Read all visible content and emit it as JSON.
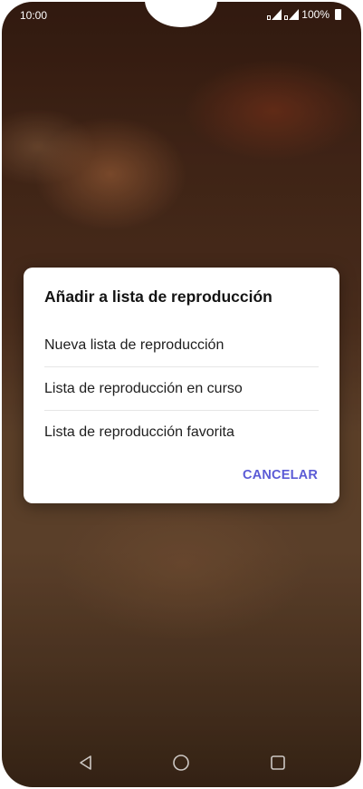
{
  "status_bar": {
    "time": "10:00",
    "battery_percent": "100%",
    "icons": [
      "signal-icon",
      "signal-icon",
      "battery-icon"
    ]
  },
  "dialog": {
    "title": "Añadir a lista de reproducción",
    "options": [
      {
        "label": "Nueva lista de reproducción"
      },
      {
        "label": "Lista de reproducción en curso"
      },
      {
        "label": "Lista de reproducción favorita"
      }
    ],
    "cancel_label": "CANCELAR",
    "accent_color": "#5b5bd6"
  },
  "nav_bar": {
    "icons": [
      "back-icon",
      "home-icon",
      "recent-apps-icon"
    ]
  }
}
